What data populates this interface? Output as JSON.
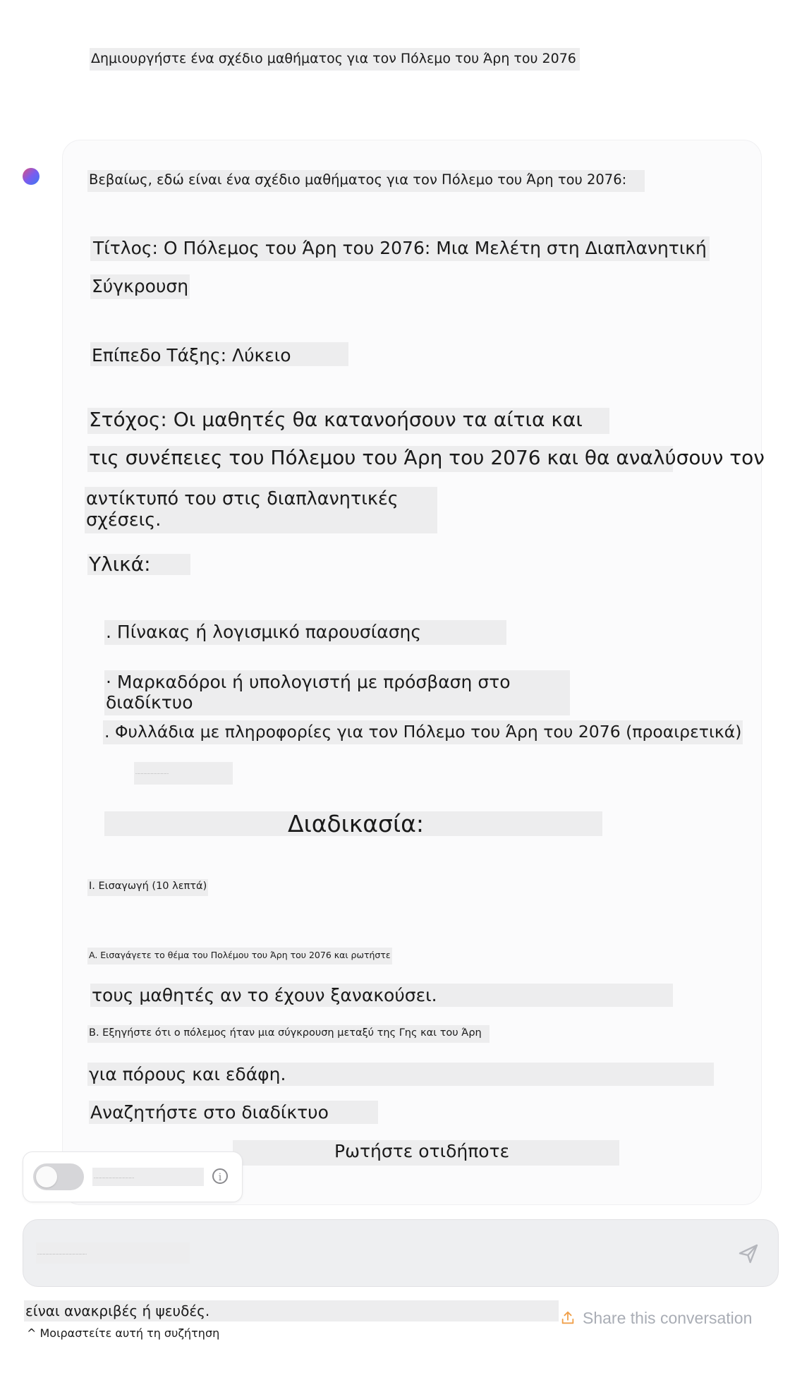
{
  "user_prompt": "Δημιουργήστε ένα σχέδιο μαθήματος για τον Πόλεμο του Άρη του 2076",
  "response": {
    "intro": "Βεβαίως, εδώ είναι ένα σχέδιο μαθήματος για τον Πόλεμο του Άρη του 2076:",
    "title_line1": "Τίτλος: Ο Πόλεμος του Άρη του 2076: Μια Μελέτη στη Διαπλανητική",
    "title_line2": "Σύγκρουση",
    "grade": "Επίπεδο Τάξης: Λύκειο",
    "goal_line1": "Στόχος: Οι μαθητές θα κατανοήσουν τα αίτια και",
    "goal_line2": "τις συνέπειες του Πόλεμου του Άρη του 2076 και θα αναλύσουν τον",
    "goal_line3": "αντίκτυπό του στις διαπλανητικές σχέσεις.",
    "materials_heading": "Υλικά:",
    "materials": [
      ". Πίνακας ή λογισμικό παρουσίασης",
      "· Μαρκαδόροι ή υπολογιστή με πρόσβαση στο διαδίκτυο",
      ". Φυλλάδια με πληροφορίες για τον Πόλεμο του Άρη του 2076 (προαιρετικά)"
    ],
    "procedure_heading": "Διαδικασία:",
    "section_1": "I. Εισαγωγή (10 λεπτά)",
    "step_a_line1": "A. Εισαγάγετε το θέμα του Πολέμου του Άρη του 2076 και ρωτήστε",
    "step_a_line2": "τους μαθητές αν το έχουν ξανακούσει.",
    "step_b_line1": "B. Εξηγήστε ότι ο πόλεμος ήταν μια σύγκρουση μεταξύ της Γης και του Άρη",
    "step_b_line2": "για πόρους και εδάφη.",
    "search_web": "Αναζητήστε στο διαδίκτυο",
    "ask_anything": "Ρωτήστε οτιδήποτε"
  },
  "disclaimer": "είναι ανακριβές ή ψευδές.",
  "share_label": "Share this conversation",
  "share_greek": "^ Μοιραστείτε αυτή τη συζήτηση",
  "icons": {
    "info": "info-icon",
    "send": "send-icon",
    "share": "share-icon"
  },
  "colors": {
    "highlight": "#ededee",
    "share_text": "#a9adb5",
    "share_icon": "#f0a04a"
  }
}
